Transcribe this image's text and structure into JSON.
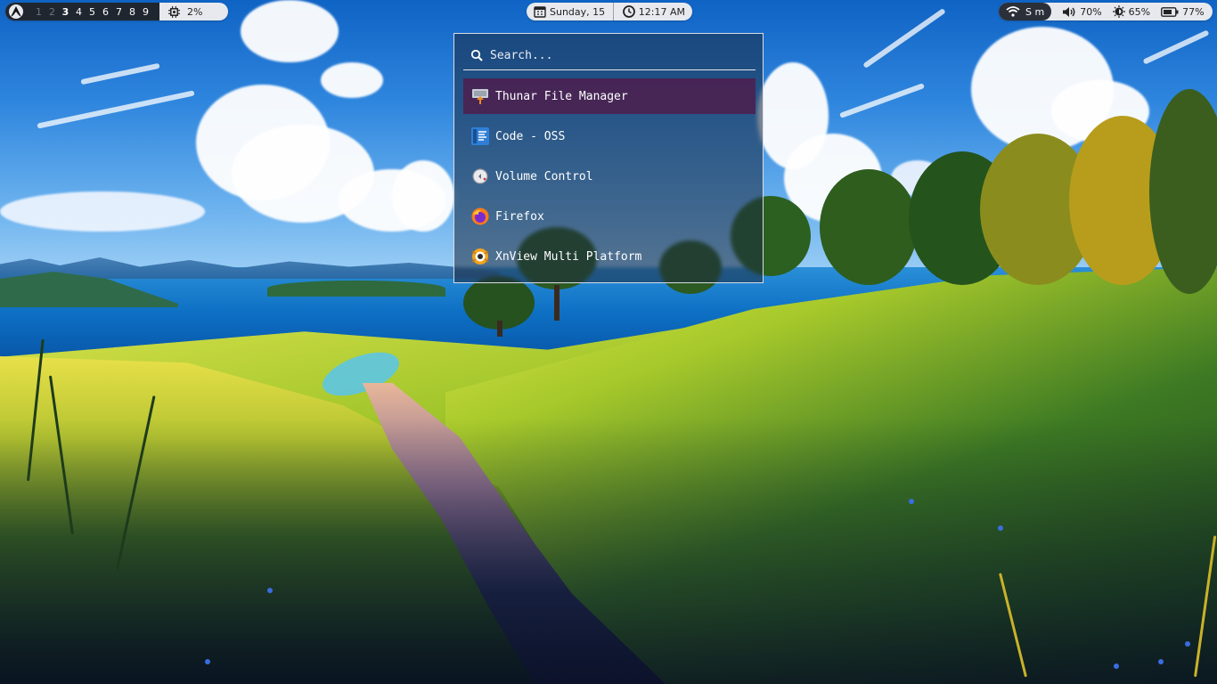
{
  "topbar": {
    "workspaces": [
      "1",
      "2",
      "3",
      "4",
      "5",
      "6",
      "7",
      "8",
      "9"
    ],
    "cpu_label": "2%",
    "date": "Sunday, 15",
    "time": "12:17 AM",
    "wifi_label": "S m",
    "volume": "70%",
    "brightness": "65%",
    "battery": "77%"
  },
  "launcher": {
    "search_placeholder": "Search...",
    "entries": [
      {
        "label": "Thunar File Manager",
        "icon": "file-manager-icon",
        "selected": true
      },
      {
        "label": "Code - OSS",
        "icon": "code-editor-icon",
        "selected": false
      },
      {
        "label": "Volume Control",
        "icon": "volume-control-icon",
        "selected": false
      },
      {
        "label": "Firefox",
        "icon": "firefox-icon",
        "selected": false
      },
      {
        "label": "XnView Multi Platform",
        "icon": "xnview-icon",
        "selected": false
      }
    ]
  },
  "colors": {
    "selected_entry": "#4e1e4e",
    "panel_pill": "#e7e9ee",
    "workspace_bg": "#20262f"
  }
}
